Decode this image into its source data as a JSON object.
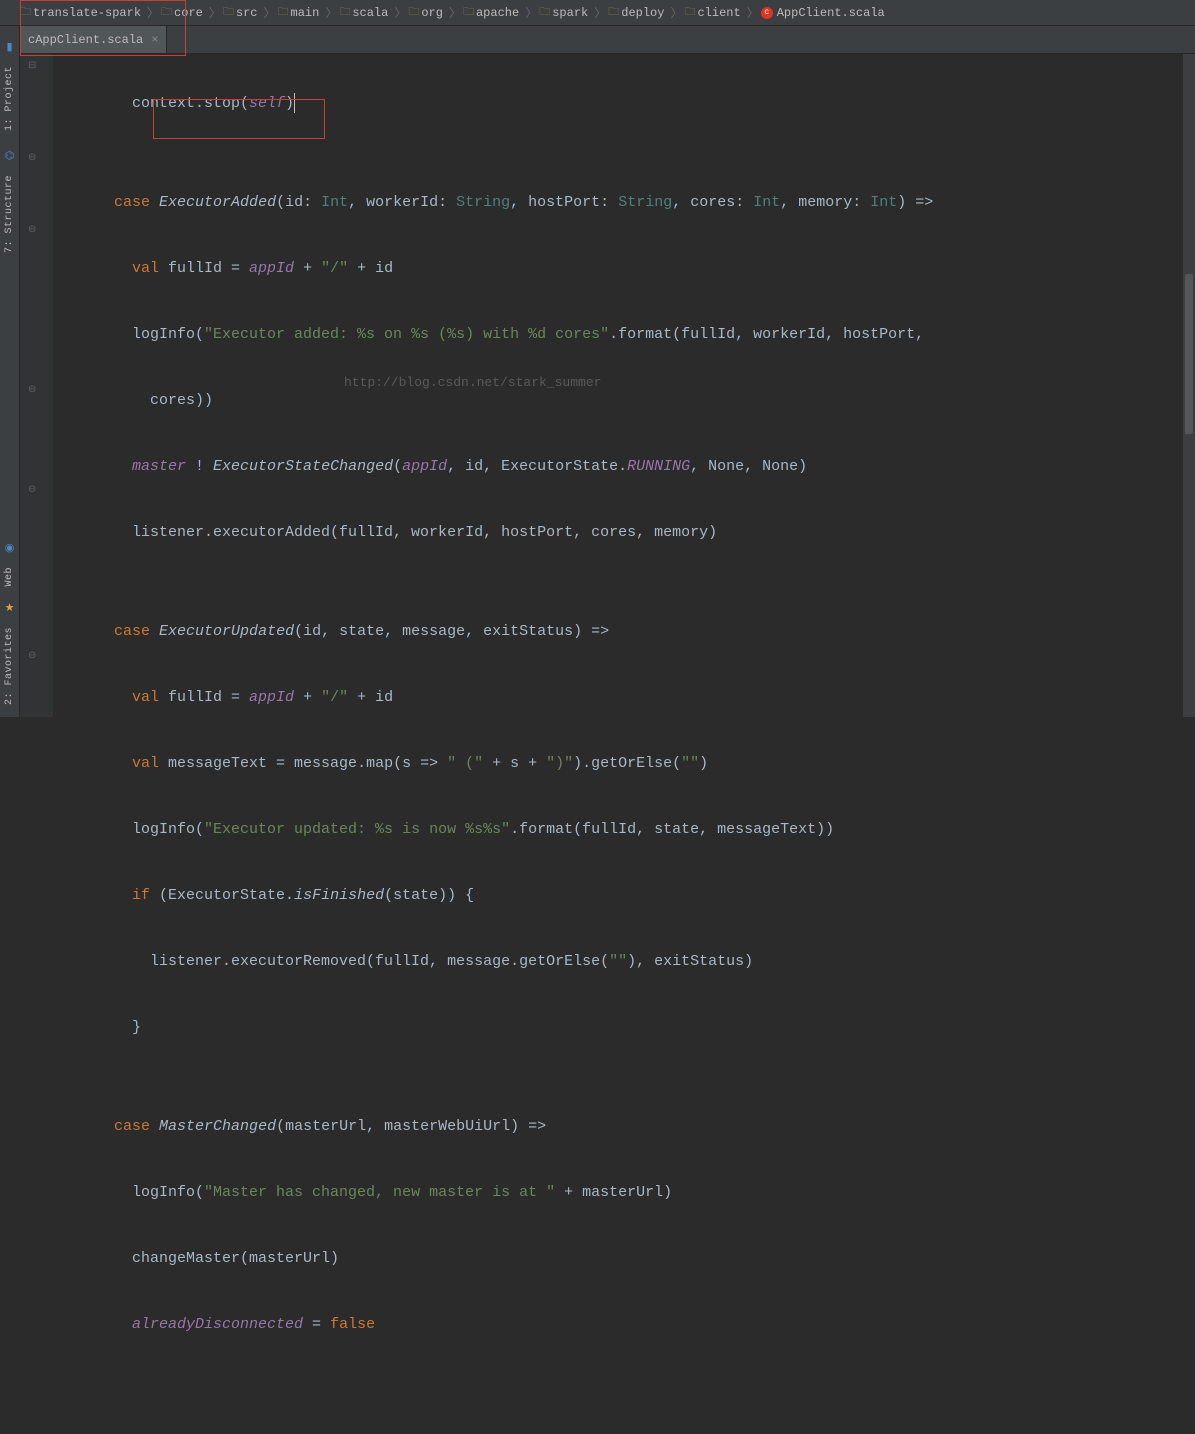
{
  "breadcrumb": [
    {
      "type": "folder",
      "label": "translate-spark"
    },
    {
      "type": "folder",
      "label": "core"
    },
    {
      "type": "folder",
      "label": "src"
    },
    {
      "type": "folder",
      "label": "main"
    },
    {
      "type": "folder",
      "label": "scala"
    },
    {
      "type": "folder",
      "label": "org"
    },
    {
      "type": "folder",
      "label": "apache"
    },
    {
      "type": "folder",
      "label": "spark"
    },
    {
      "type": "folder",
      "label": "deploy"
    },
    {
      "type": "folder",
      "label": "client"
    },
    {
      "type": "scala",
      "label": "AppClient.scala"
    }
  ],
  "tab": {
    "label": "AppClient.scala"
  },
  "toolwindows": {
    "project": "1: Project",
    "structure": "7: Structure",
    "web": "Web",
    "favorites": "2: Favorites"
  },
  "watermark": "http://blog.csdn.net/stark_summer",
  "code": {
    "l0_a": "        context.stop(",
    "l0_b": "self",
    "l0_c": ")",
    "l1": "",
    "l2_case": "case",
    "l2_class": "ExecutorAdded",
    "l2_a": "(id: ",
    "l2_t1": "Int",
    "l2_b": ", workerId: ",
    "l2_t2": "String",
    "l2_c": ", hostPort: ",
    "l2_t3": "String",
    "l2_d": ", cores: ",
    "l2_t4": "Int",
    "l2_e": ", memory: ",
    "l2_t5": "Int",
    "l2_f": ") =>",
    "l3_val": "val",
    "l3_a": " fullId = ",
    "l3_field": "appId",
    "l3_b": " + ",
    "l3_str": "\"/\"",
    "l3_c": " + id",
    "l4_a": "        logInfo(",
    "l4_str": "\"Executor added: %s on %s (%s) with %d cores\"",
    "l4_b": ".format(fullId, workerId, hostPort,",
    "l5_a": "          cores))",
    "l6_field": "master",
    "l6_a": " ! ",
    "l6_class": "ExecutorStateChanged",
    "l6_b": "(",
    "l6_field2": "appId",
    "l6_c": ", id, ExecutorState.",
    "l6_const": "RUNNING",
    "l6_d": ", None, None)",
    "l7_a": "        listener.executorAdded(fullId, workerId, hostPort, cores, memory)",
    "l8": "",
    "l9_case": "case",
    "l9_class": "ExecutorUpdated",
    "l9_a": "(id, state, message, exitStatus) =>",
    "l10_val": "val",
    "l10_a": " fullId = ",
    "l10_field": "appId",
    "l10_b": " + ",
    "l10_str": "\"/\"",
    "l10_c": " + id",
    "l11_val": "val",
    "l11_a": " messageText = message.map(s => ",
    "l11_str1": "\" (\"",
    "l11_b": " + s + ",
    "l11_str2": "\")\"",
    "l11_c": ").getOrElse(",
    "l11_str3": "\"\"",
    "l11_d": ")",
    "l12_a": "        logInfo(",
    "l12_str": "\"Executor updated: %s is now %s%s\"",
    "l12_b": ".format(fullId, state, messageText))",
    "l13_if": "if",
    "l13_a": " (ExecutorState.",
    "l13_m": "isFinished",
    "l13_b": "(state)) {",
    "l14_a": "          listener.executorRemoved(fullId, message.getOrElse(",
    "l14_str": "\"\"",
    "l14_b": "), exitStatus)",
    "l15_a": "        }",
    "l16": "",
    "l17_case": "case",
    "l17_class": "MasterChanged",
    "l17_a": "(masterUrl, masterWebUiUrl) =>",
    "l18_a": "        logInfo(",
    "l18_str": "\"Master has changed, new master is at \"",
    "l18_b": " + masterUrl)",
    "l19_a": "        changeMaster(masterUrl)",
    "l20_a": "        ",
    "l20_field": "alreadyDisconnected",
    "l20_b": " = ",
    "l20_kw": "false"
  }
}
